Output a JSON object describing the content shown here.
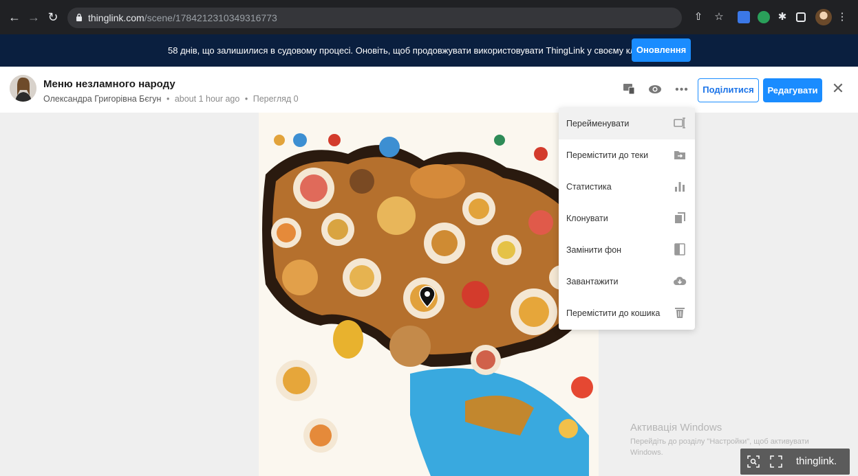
{
  "browser": {
    "url_host": "thinglink.com",
    "url_path": "/scene/1784212310349316773"
  },
  "banner": {
    "message": "58 днів, що залишилися в судовому процесі. Оновіть, щоб продовжувати використовувати ThingLink у своєму класі.",
    "update_label": "Оновлення"
  },
  "header": {
    "title": "Меню незламного народу",
    "author": "Олександра Григорівна Бєгун",
    "separator": "•",
    "time": "about 1 hour ago",
    "views": "Перегляд 0",
    "share_label": "Поділитися",
    "edit_label": "Редагувати"
  },
  "menu": {
    "items": [
      {
        "label": "Перейменувати",
        "icon": "rename-icon"
      },
      {
        "label": "Перемістити до теки",
        "icon": "move-folder-icon"
      },
      {
        "label": "Статистика",
        "icon": "stats-icon"
      },
      {
        "label": "Клонувати",
        "icon": "clone-icon"
      },
      {
        "label": "Замінити фон",
        "icon": "replace-background-icon"
      },
      {
        "label": "Завантажити",
        "icon": "download-cloud-icon"
      },
      {
        "label": "Перемістити до кошика",
        "icon": "trash-icon"
      }
    ]
  },
  "watermark": {
    "title": "Активація Windows",
    "text": "Перейдіть до розділу \"Настройки\", щоб активувати Windows."
  },
  "toolbar": {
    "brand": "thinglink."
  },
  "colors": {
    "accent": "#1a8cff",
    "banner_bg": "#0a1f3f",
    "chrome_bg": "#202124"
  }
}
